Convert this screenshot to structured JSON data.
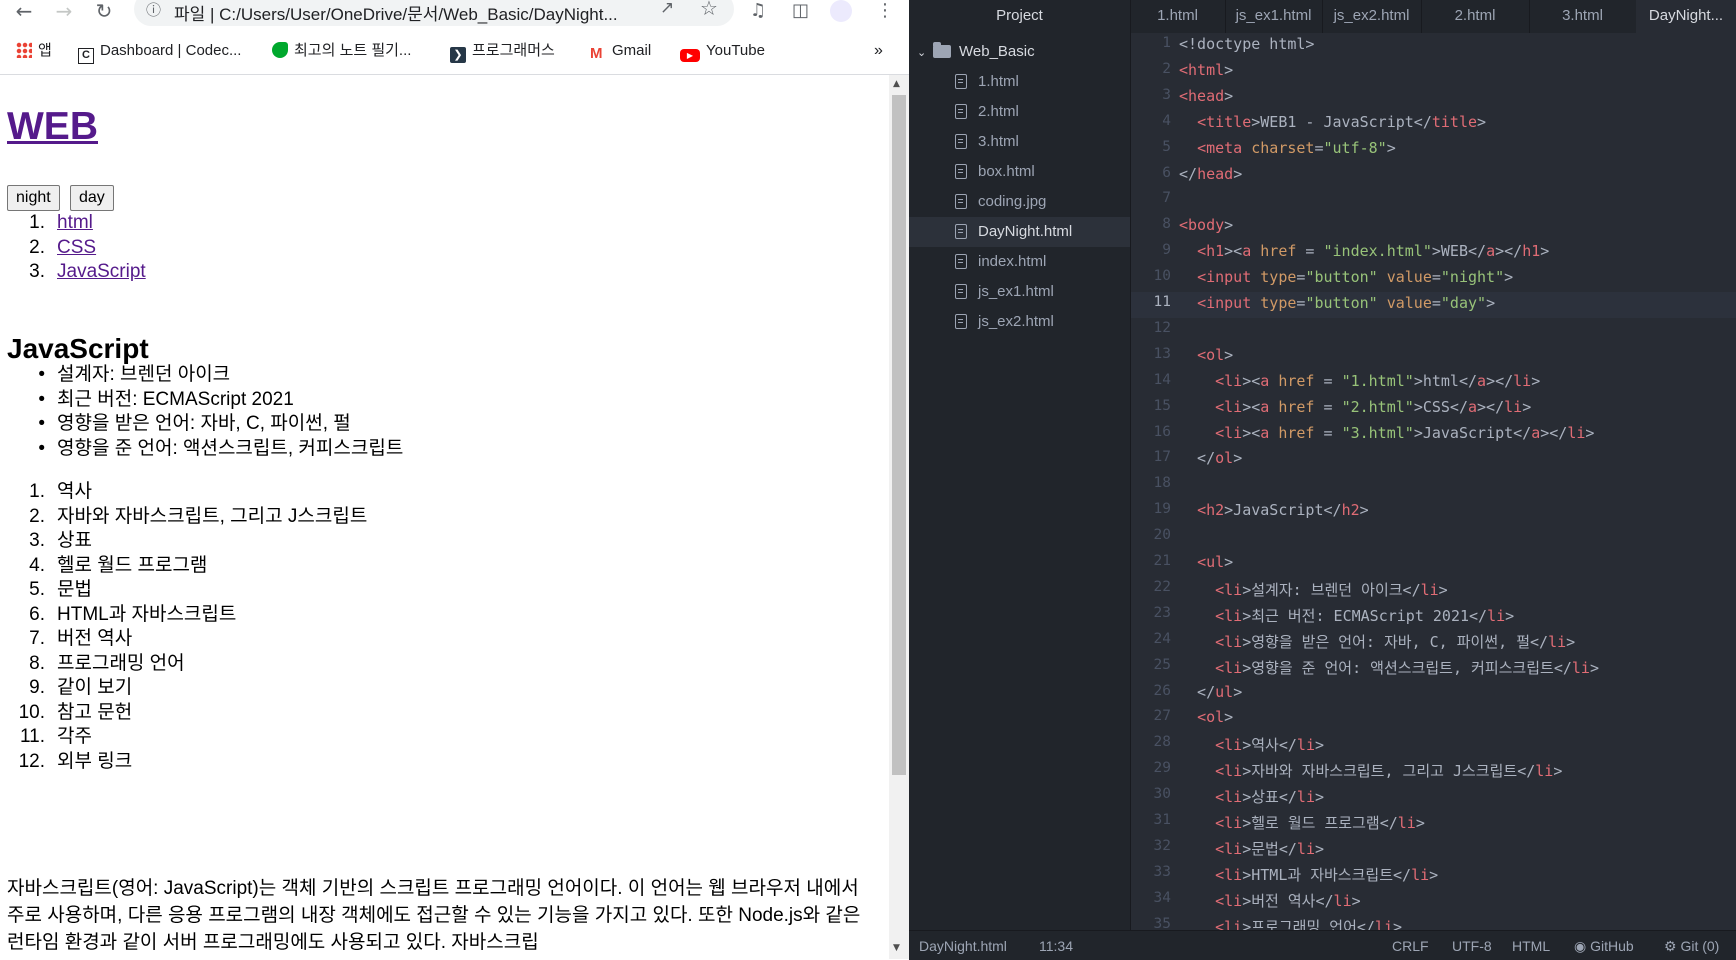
{
  "browser": {
    "url_prefix": "파일",
    "url": "C:/Users/User/OneDrive/문서/Web_Basic/DayNight...",
    "bookmarks": [
      {
        "label": "앱",
        "icon": "apps-grid-icon"
      },
      {
        "label": "Dashboard | Codec...",
        "icon": "codecademy-icon"
      },
      {
        "label": "최고의 노트 필기...",
        "icon": "evernote-icon"
      },
      {
        "label": "프로그래머스",
        "icon": "programmers-icon"
      },
      {
        "label": "Gmail",
        "icon": "gmail-icon"
      },
      {
        "label": "YouTube",
        "icon": "youtube-icon"
      }
    ],
    "bookmarks_more": "»"
  },
  "page": {
    "title": "WEB",
    "buttons": [
      "night",
      "day"
    ],
    "nav": [
      {
        "n": "1.",
        "label": "html"
      },
      {
        "n": "2.",
        "label": "CSS"
      },
      {
        "n": "3.",
        "label": "JavaScript"
      }
    ],
    "heading": "JavaScript",
    "facts": [
      "설계자: 브렌던 아이크",
      "최근 버전: ECMAScript 2021",
      "영향을 받은 언어: 자바, C, 파이썬, 펄",
      "영향을 준 언어: 액션스크립트, 커피스크립트"
    ],
    "toc": [
      {
        "n": "1.",
        "label": "역사"
      },
      {
        "n": "2.",
        "label": "자바와 자바스크립트, 그리고 J스크립트"
      },
      {
        "n": "3.",
        "label": "상표"
      },
      {
        "n": "4.",
        "label": "헬로 월드 프로그램"
      },
      {
        "n": "5.",
        "label": "문법"
      },
      {
        "n": "6.",
        "label": "HTML과 자바스크립트"
      },
      {
        "n": "7.",
        "label": "버전 역사"
      },
      {
        "n": "8.",
        "label": "프로그래밍 언어"
      },
      {
        "n": "9.",
        "label": "같이 보기"
      },
      {
        "n": "10.",
        "label": "참고 문헌"
      },
      {
        "n": "11.",
        "label": "각주"
      },
      {
        "n": "12.",
        "label": "외부 링크"
      }
    ],
    "paragraph": "자바스크립트(영어: JavaScript)는 객체 기반의 스크립트 프로그래밍 언어이다. 이 언어는 웹 브라우저 내에서 주로 사용하며, 다른 응용 프로그램의 내장 객체에도 접근할 수 있는 기능을 가지고 있다. 또한 Node.js와 같은 런타임 환경과 같이 서버 프로그래밍에도 사용되고 있다. 자바스크립"
  },
  "editor": {
    "project_title": "Project",
    "tabs": [
      "1.html",
      "js_ex1.html",
      "js_ex2.html",
      "2.html",
      "3.html",
      "DayNight..."
    ],
    "active_tab": 5,
    "folder": "Web_Basic",
    "files": [
      {
        "name": "1.html",
        "icon": "file-text-icon"
      },
      {
        "name": "2.html",
        "icon": "file-text-icon"
      },
      {
        "name": "3.html",
        "icon": "file-text-icon"
      },
      {
        "name": "box.html",
        "icon": "file-text-icon"
      },
      {
        "name": "coding.jpg",
        "icon": "file-image-icon"
      },
      {
        "name": "DayNight.html",
        "icon": "file-text-icon",
        "selected": true
      },
      {
        "name": "index.html",
        "icon": "file-text-icon"
      },
      {
        "name": "js_ex1.html",
        "icon": "file-text-icon"
      },
      {
        "name": "js_ex2.html",
        "icon": "file-text-icon"
      }
    ],
    "current_line": 11,
    "code_lines": [
      [
        [
          "p",
          "<!doctype html>"
        ]
      ],
      [
        [
          "t",
          "<html"
        ],
        [
          "p",
          ">"
        ]
      ],
      [
        [
          "t",
          "<head"
        ],
        [
          "p",
          ">"
        ]
      ],
      [
        [
          "p",
          "  "
        ],
        [
          "t",
          "<title"
        ],
        [
          "p",
          ">WEB1 - JavaScript</"
        ],
        [
          "t",
          "title"
        ],
        [
          "p",
          ">"
        ]
      ],
      [
        [
          "p",
          "  "
        ],
        [
          "t",
          "<meta"
        ],
        [
          "a",
          " charset"
        ],
        [
          "p",
          "="
        ],
        [
          "s",
          "\"utf-8\""
        ],
        [
          "p",
          ">"
        ]
      ],
      [
        [
          "p",
          "</"
        ],
        [
          "t",
          "head"
        ],
        [
          "p",
          ">"
        ]
      ],
      [
        [
          "p",
          ""
        ]
      ],
      [
        [
          "t",
          "<body"
        ],
        [
          "p",
          ">"
        ]
      ],
      [
        [
          "p",
          "  "
        ],
        [
          "t",
          "<h1"
        ],
        [
          "p",
          "><"
        ],
        [
          "t",
          "a"
        ],
        [
          "a",
          " href"
        ],
        [
          "p",
          " = "
        ],
        [
          "s",
          "\"index.html\""
        ],
        [
          "p",
          ">WEB</"
        ],
        [
          "t",
          "a"
        ],
        [
          "p",
          "></"
        ],
        [
          "t",
          "h1"
        ],
        [
          "p",
          ">"
        ]
      ],
      [
        [
          "p",
          "  "
        ],
        [
          "t",
          "<input"
        ],
        [
          "a",
          " type"
        ],
        [
          "p",
          "="
        ],
        [
          "s",
          "\"button\""
        ],
        [
          "a",
          " value"
        ],
        [
          "p",
          "="
        ],
        [
          "s",
          "\"night\""
        ],
        [
          "p",
          ">"
        ]
      ],
      [
        [
          "p",
          "  "
        ],
        [
          "t",
          "<input"
        ],
        [
          "a",
          " type"
        ],
        [
          "p",
          "="
        ],
        [
          "s",
          "\"button\""
        ],
        [
          "a",
          " value"
        ],
        [
          "p",
          "="
        ],
        [
          "s",
          "\"day\""
        ],
        [
          "p",
          ">"
        ]
      ],
      [
        [
          "p",
          ""
        ]
      ],
      [
        [
          "p",
          "  "
        ],
        [
          "t",
          "<ol"
        ],
        [
          "p",
          ">"
        ]
      ],
      [
        [
          "p",
          "    "
        ],
        [
          "t",
          "<li"
        ],
        [
          "p",
          "><"
        ],
        [
          "t",
          "a"
        ],
        [
          "a",
          " href"
        ],
        [
          "p",
          " = "
        ],
        [
          "s",
          "\"1.html\""
        ],
        [
          "p",
          ">html</"
        ],
        [
          "t",
          "a"
        ],
        [
          "p",
          "></"
        ],
        [
          "t",
          "li"
        ],
        [
          "p",
          ">"
        ]
      ],
      [
        [
          "p",
          "    "
        ],
        [
          "t",
          "<li"
        ],
        [
          "p",
          "><"
        ],
        [
          "t",
          "a"
        ],
        [
          "a",
          " href"
        ],
        [
          "p",
          " = "
        ],
        [
          "s",
          "\"2.html\""
        ],
        [
          "p",
          ">CSS</"
        ],
        [
          "t",
          "a"
        ],
        [
          "p",
          "></"
        ],
        [
          "t",
          "li"
        ],
        [
          "p",
          ">"
        ]
      ],
      [
        [
          "p",
          "    "
        ],
        [
          "t",
          "<li"
        ],
        [
          "p",
          "><"
        ],
        [
          "t",
          "a"
        ],
        [
          "a",
          " href"
        ],
        [
          "p",
          " = "
        ],
        [
          "s",
          "\"3.html\""
        ],
        [
          "p",
          ">JavaScript</"
        ],
        [
          "t",
          "a"
        ],
        [
          "p",
          "></"
        ],
        [
          "t",
          "li"
        ],
        [
          "p",
          ">"
        ]
      ],
      [
        [
          "p",
          "  </"
        ],
        [
          "t",
          "ol"
        ],
        [
          "p",
          ">"
        ]
      ],
      [
        [
          "p",
          ""
        ]
      ],
      [
        [
          "p",
          "  "
        ],
        [
          "t",
          "<h2"
        ],
        [
          "p",
          ">JavaScript</"
        ],
        [
          "t",
          "h2"
        ],
        [
          "p",
          ">"
        ]
      ],
      [
        [
          "p",
          ""
        ]
      ],
      [
        [
          "p",
          "  "
        ],
        [
          "t",
          "<ul"
        ],
        [
          "p",
          ">"
        ]
      ],
      [
        [
          "p",
          "    "
        ],
        [
          "t",
          "<li"
        ],
        [
          "p",
          ">설계자: 브렌던 아이크</"
        ],
        [
          "t",
          "li"
        ],
        [
          "p",
          ">"
        ]
      ],
      [
        [
          "p",
          "    "
        ],
        [
          "t",
          "<li"
        ],
        [
          "p",
          ">최근 버전: ECMAScript 2021</"
        ],
        [
          "t",
          "li"
        ],
        [
          "p",
          ">"
        ]
      ],
      [
        [
          "p",
          "    "
        ],
        [
          "t",
          "<li"
        ],
        [
          "p",
          ">영향을 받은 언어: 자바, C, 파이썬, 펄</"
        ],
        [
          "t",
          "li"
        ],
        [
          "p",
          ">"
        ]
      ],
      [
        [
          "p",
          "    "
        ],
        [
          "t",
          "<li"
        ],
        [
          "p",
          ">영향을 준 언어: 액션스크립트, 커피스크립트</"
        ],
        [
          "t",
          "li"
        ],
        [
          "p",
          ">"
        ]
      ],
      [
        [
          "p",
          "  </"
        ],
        [
          "t",
          "ul"
        ],
        [
          "p",
          ">"
        ]
      ],
      [
        [
          "p",
          "  "
        ],
        [
          "t",
          "<ol"
        ],
        [
          "p",
          ">"
        ]
      ],
      [
        [
          "p",
          "    "
        ],
        [
          "t",
          "<li"
        ],
        [
          "p",
          ">역사</"
        ],
        [
          "t",
          "li"
        ],
        [
          "p",
          ">"
        ]
      ],
      [
        [
          "p",
          "    "
        ],
        [
          "t",
          "<li"
        ],
        [
          "p",
          ">자바와 자바스크립트, 그리고 J스크립트</"
        ],
        [
          "t",
          "li"
        ],
        [
          "p",
          ">"
        ]
      ],
      [
        [
          "p",
          "    "
        ],
        [
          "t",
          "<li"
        ],
        [
          "p",
          ">상표</"
        ],
        [
          "t",
          "li"
        ],
        [
          "p",
          ">"
        ]
      ],
      [
        [
          "p",
          "    "
        ],
        [
          "t",
          "<li"
        ],
        [
          "p",
          ">헬로 월드 프로그램</"
        ],
        [
          "t",
          "li"
        ],
        [
          "p",
          ">"
        ]
      ],
      [
        [
          "p",
          "    "
        ],
        [
          "t",
          "<li"
        ],
        [
          "p",
          ">문법</"
        ],
        [
          "t",
          "li"
        ],
        [
          "p",
          ">"
        ]
      ],
      [
        [
          "p",
          "    "
        ],
        [
          "t",
          "<li"
        ],
        [
          "p",
          ">HTML과 자바스크립트</"
        ],
        [
          "t",
          "li"
        ],
        [
          "p",
          ">"
        ]
      ],
      [
        [
          "p",
          "    "
        ],
        [
          "t",
          "<li"
        ],
        [
          "p",
          ">버전 역사</"
        ],
        [
          "t",
          "li"
        ],
        [
          "p",
          ">"
        ]
      ],
      [
        [
          "p",
          "    "
        ],
        [
          "t",
          "<li"
        ],
        [
          "p",
          ">프로그래밍 언어</"
        ],
        [
          "t",
          "li"
        ],
        [
          "p",
          ">"
        ]
      ]
    ],
    "status": {
      "file": "DayNight.html",
      "cursor": "11:34",
      "line_ending": "CRLF",
      "encoding": "UTF-8",
      "grammar": "HTML",
      "github": "GitHub",
      "git": "Git (0)"
    },
    "colors": {
      "tag": "#e06c75",
      "attr": "#d19a66",
      "string": "#98c379",
      "text": "#abb2bf",
      "bg": "#282c34"
    }
  }
}
